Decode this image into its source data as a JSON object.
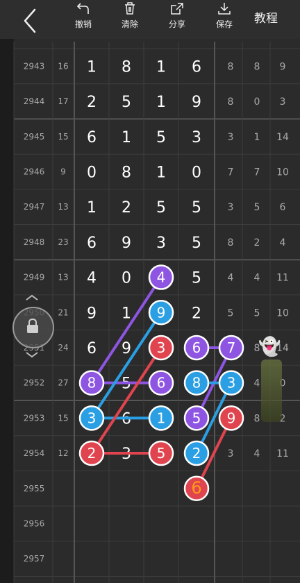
{
  "toolbar": {
    "undo_label": "撤销",
    "clear_label": "清除",
    "share_label": "分享",
    "save_label": "保存",
    "tutorial_label": "教程"
  },
  "table": {
    "rows": [
      {
        "period": "2943",
        "sum": "16",
        "digits": [
          "1",
          "8",
          "1",
          "6"
        ],
        "stats": [
          "8",
          "8",
          "9"
        ]
      },
      {
        "period": "2944",
        "sum": "17",
        "digits": [
          "2",
          "5",
          "1",
          "9"
        ],
        "stats": [
          "8",
          "0",
          "3"
        ]
      },
      {
        "period": "2945",
        "sum": "15",
        "digits": [
          "6",
          "1",
          "5",
          "3"
        ],
        "stats": [
          "3",
          "1",
          "14"
        ]
      },
      {
        "period": "2946",
        "sum": "9",
        "digits": [
          "0",
          "8",
          "1",
          "0"
        ],
        "stats": [
          "7",
          "7",
          "10"
        ]
      },
      {
        "period": "2947",
        "sum": "13",
        "digits": [
          "1",
          "2",
          "5",
          "5"
        ],
        "stats": [
          "3",
          "5",
          "6"
        ]
      },
      {
        "period": "2948",
        "sum": "23",
        "digits": [
          "6",
          "9",
          "3",
          "5"
        ],
        "stats": [
          "8",
          "2",
          "4"
        ]
      },
      {
        "period": "2949",
        "sum": "13",
        "digits": [
          "4",
          "0",
          "",
          "5"
        ],
        "stats": [
          "4",
          "4",
          "11"
        ]
      },
      {
        "period": "2950",
        "sum": "21",
        "digits": [
          "9",
          "1",
          "",
          "2"
        ],
        "stats": [
          "5",
          "5",
          "10"
        ]
      },
      {
        "period": "2951",
        "sum": "24",
        "digits": [
          "6",
          "9",
          "",
          ""
        ],
        "stats": [
          "",
          "8",
          "14"
        ]
      },
      {
        "period": "2952",
        "sum": "27",
        "digits": [
          "",
          "5",
          "",
          ""
        ],
        "stats": [
          "",
          "4",
          "0"
        ]
      },
      {
        "period": "2953",
        "sum": "15",
        "digits": [
          "",
          "6",
          "",
          ""
        ],
        "stats": [
          "",
          "8",
          "2"
        ]
      },
      {
        "period": "2954",
        "sum": "12",
        "digits": [
          "",
          "3",
          "",
          ""
        ],
        "stats": [
          "3",
          "4",
          "11"
        ]
      },
      {
        "period": "2955",
        "sum": "",
        "digits": [
          "",
          "",
          "",
          ""
        ],
        "stats": [
          "",
          "",
          ""
        ]
      },
      {
        "period": "2956",
        "sum": "",
        "digits": [
          "",
          "",
          "",
          ""
        ],
        "stats": [
          "",
          "",
          ""
        ]
      },
      {
        "period": "2957",
        "sum": "",
        "digits": [
          "",
          "",
          "",
          ""
        ],
        "stats": [
          "",
          "",
          ""
        ]
      }
    ]
  },
  "overlay": {
    "chains": [
      {
        "color": "#8e55e2",
        "balls": [
          {
            "row": 6,
            "col": 2,
            "label": "4"
          },
          {
            "row": 9,
            "col": 0,
            "label": "8"
          },
          {
            "row": 9,
            "col": 2,
            "label": "6"
          }
        ]
      },
      {
        "color": "#2a9fe3",
        "balls": [
          {
            "row": 7,
            "col": 2,
            "label": "9"
          },
          {
            "row": 10,
            "col": 0,
            "label": "3"
          },
          {
            "row": 10,
            "col": 2,
            "label": "1"
          }
        ]
      },
      {
        "color": "#e0444f",
        "balls": [
          {
            "row": 8,
            "col": 2,
            "label": "3"
          },
          {
            "row": 11,
            "col": 0,
            "label": "2"
          },
          {
            "row": 11,
            "col": 2,
            "label": "5"
          }
        ]
      },
      {
        "color": "#8e55e2",
        "balls": [
          {
            "row": 8,
            "col": 3,
            "label": "6"
          },
          {
            "row": 8,
            "col": 4,
            "label": "7"
          },
          {
            "row": 10,
            "col": 3,
            "label": "5"
          }
        ]
      },
      {
        "color": "#2a9fe3",
        "balls": [
          {
            "row": 9,
            "col": 3,
            "label": "8"
          },
          {
            "row": 9,
            "col": 4,
            "label": "3"
          },
          {
            "row": 11,
            "col": 3,
            "label": "2"
          }
        ]
      },
      {
        "color": "#e0444f",
        "balls": [
          {
            "row": 10,
            "col": 4,
            "label": "9"
          },
          {
            "row": 12,
            "col": 3,
            "label": "6"
          }
        ]
      }
    ],
    "special_ball_text_color": "#ff9a1a"
  },
  "widgets": {
    "ghost_icon": "👻"
  }
}
